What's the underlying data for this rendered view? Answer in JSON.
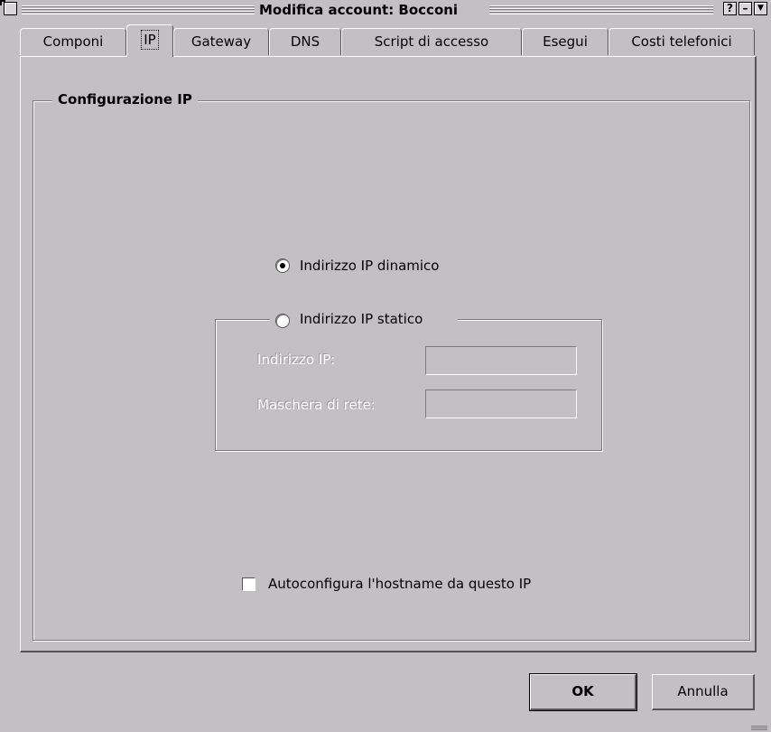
{
  "window": {
    "title": "Modifica account: Bocconi",
    "help_glyph": "?",
    "minimize_glyph": "–",
    "menu_glyph": "▼"
  },
  "tabs": [
    {
      "label": "Componi",
      "active": false
    },
    {
      "label": "IP",
      "active": true
    },
    {
      "label": "Gateway",
      "active": false
    },
    {
      "label": "DNS",
      "active": false
    },
    {
      "label": "Script di accesso",
      "active": false
    },
    {
      "label": "Esegui",
      "active": false
    },
    {
      "label": "Costi telefonici",
      "active": false
    }
  ],
  "ip_config": {
    "group_title": "Configurazione IP",
    "dynamic_label": "Indirizzo IP dinamico",
    "dynamic_selected": true,
    "static_label": "Indirizzo IP statico",
    "static_selected": false,
    "ip_address_label": "Indirizzo IP:",
    "ip_address_value": "",
    "netmask_label": "Maschera di rete:",
    "netmask_value": "",
    "autoconf_label": "Autoconfigura l'hostname da questo IP",
    "autoconf_checked": false
  },
  "buttons": {
    "ok": "OK",
    "cancel": "Annulla"
  },
  "colors": {
    "window_bg": "#c3c0c3",
    "field_bg": "#ffffff",
    "shadow": "#555555",
    "highlight": "#ffffff"
  }
}
